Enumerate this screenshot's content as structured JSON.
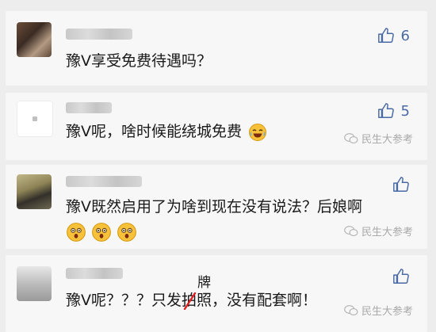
{
  "comments": [
    {
      "text": "豫V享受免费待遇吗？",
      "likes": "6",
      "watermark": ""
    },
    {
      "text": "豫V呢，啥时候能绕城免费",
      "likes": "5",
      "watermark": "民生大参考"
    },
    {
      "text": "豫V既然启用了为啥到现在没有说法？后娘啊",
      "likes": "",
      "watermark": "民生大参考"
    },
    {
      "text_before": "豫V呢？？？只发",
      "struck_char": "拍",
      "correction_char": "牌",
      "text_after": "照，没有配套啊！",
      "likes": "",
      "watermark": "民生大参考"
    }
  ],
  "icons": {
    "like": "thumbs-up-icon",
    "laugh": "tears-of-joy-emoji",
    "surprised": "astonished-emoji",
    "watermark": "wechat-logo-icon"
  },
  "colors": {
    "like_blue": "#4a6aa6",
    "strike_red": "#e02020"
  }
}
